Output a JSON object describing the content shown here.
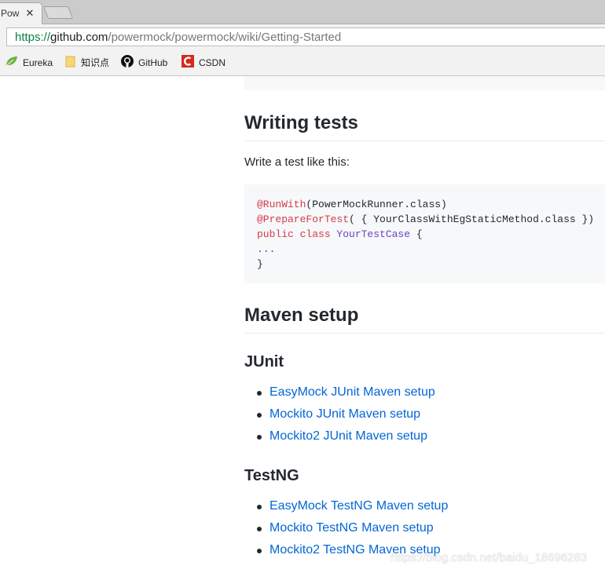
{
  "browser": {
    "tab_title": "Power",
    "tab_close_glyph": "✕",
    "url_scheme": "https://",
    "url_host": "github.com",
    "url_path": "/powermock/powermock/wiki/Getting-Started",
    "bookmarks": [
      {
        "label": "Eureka",
        "icon": "spring-leaf-icon"
      },
      {
        "label": "知识点",
        "icon": "folder-icon"
      },
      {
        "label": "GitHub",
        "icon": "github-icon"
      },
      {
        "label": "CSDN",
        "icon": "csdn-icon"
      }
    ]
  },
  "article": {
    "writing_tests": {
      "heading": "Writing tests",
      "intro": "Write a test like this:",
      "code": {
        "line1_anno": "@RunWith",
        "line1_rest": "(PowerMockRunner.class)",
        "line2_anno": "@PrepareForTest",
        "line2_rest": "( { YourClassWithEgStaticMethod.class })",
        "line3_kw": "public class ",
        "line3_cls": "YourTestCase",
        "line3_rest": " {",
        "line4": "...",
        "line5": "}"
      }
    },
    "maven_setup": {
      "heading": "Maven setup",
      "junit": {
        "heading": "JUnit",
        "links": [
          "EasyMock JUnit Maven setup",
          "Mockito JUnit Maven setup",
          "Mockito2 JUnit Maven setup"
        ]
      },
      "testng": {
        "heading": "TestNG",
        "links": [
          "EasyMock TestNG Maven setup",
          "Mockito TestNG Maven setup",
          "Mockito2 TestNG Maven setup"
        ]
      }
    }
  },
  "watermark": "https://blog.csdn.net/baidu_18696283",
  "colors": {
    "link": "#0366d6",
    "annotation": "#d73a49",
    "class_name": "#6f42c1",
    "code_bg": "#f6f8fa"
  }
}
